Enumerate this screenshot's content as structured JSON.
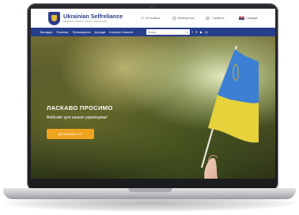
{
  "brand": {
    "name": "Ukrainian Selfreliance",
    "tagline": "FEDERAL CREDIT UNION · SINCE 1951"
  },
  "header_info": [
    {
      "icon": "building-icon",
      "text": "Our locations"
    },
    {
      "icon": "clock-icon",
      "text": "Working hours"
    },
    {
      "icon": "phone-icon",
      "text": "Contact us"
    },
    {
      "icon": "flag-icon",
      "text": "Language"
    }
  ],
  "nav": {
    "items": [
      "Вкладки",
      "Позички",
      "Приміщення",
      "Доходи",
      "Інтернет-Банкінг"
    ],
    "search_placeholder": "Пошук"
  },
  "hero": {
    "title": "ЛАСКАВО ПРОСИМО",
    "subtitle": "Вибісайт для нашою українцями!",
    "button_label": "ДЕТАЛЬНІШЕ ТУТ"
  },
  "colors": {
    "nav_bg": "#283e8b",
    "button": "#f0a31f",
    "flag_blue": "#3d7fd2",
    "flag_yellow": "#e6d23b"
  }
}
